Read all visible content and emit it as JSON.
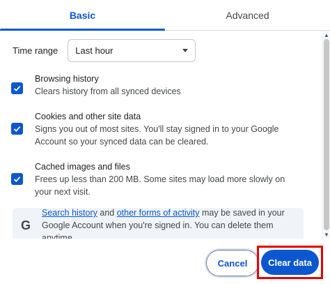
{
  "tabs": [
    {
      "label": "Basic",
      "active": true
    },
    {
      "label": "Advanced",
      "active": false
    }
  ],
  "time_range": {
    "label": "Time range",
    "value": "Last hour"
  },
  "options": [
    {
      "title": "Browsing history",
      "desc": "Clears history from all synced devices",
      "checked": true
    },
    {
      "title": "Cookies and other site data",
      "desc": "Signs you out of most sites. You'll stay signed in to your Google Account so your synced data can be cleared.",
      "checked": true
    },
    {
      "title": "Cached images and files",
      "desc": "Frees up less than 200 MB. Some sites may load more slowly on your next visit.",
      "checked": true
    }
  ],
  "info": {
    "icon": "G",
    "link1": "Search history",
    "mid": " and ",
    "link2": "other forms of activity",
    "rest": " may be saved in your Google Account when you're signed in. You can delete them anytime."
  },
  "buttons": {
    "cancel": "Cancel",
    "clear": "Clear data"
  },
  "colors": {
    "accent": "#0b57d0",
    "highlight": "#e60000",
    "info_bg": "#f0f4f9"
  }
}
